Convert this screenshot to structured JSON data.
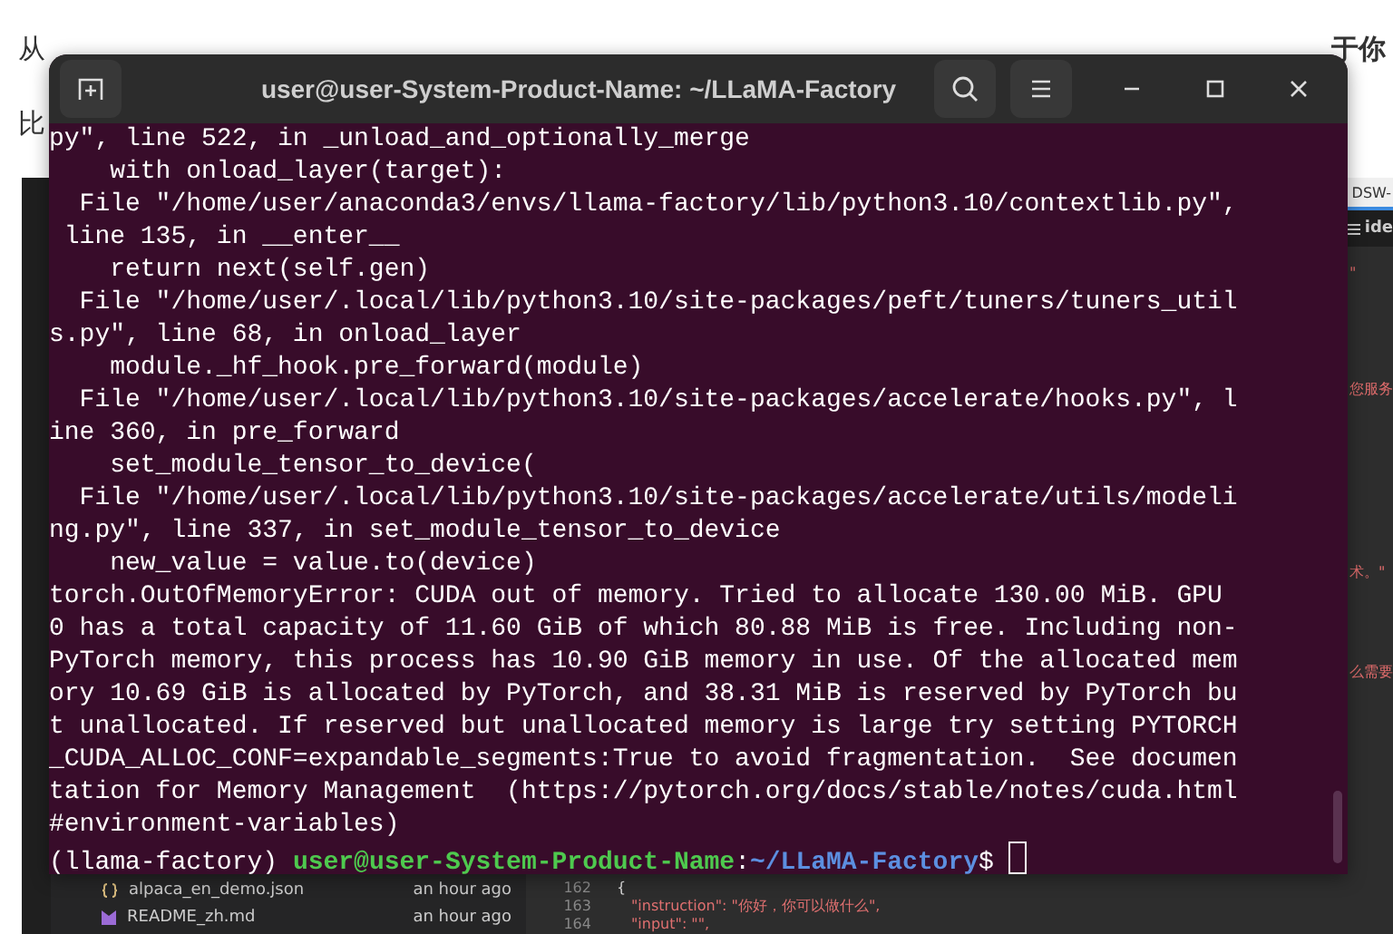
{
  "background_page": {
    "line_1_start": "从",
    "line_1_end": "于你",
    "line_2_start": "比"
  },
  "editor": {
    "top_label": "DSW-",
    "tab": "ide",
    "right_fragments": [
      "\"",
      "您服务",
      "术。\"",
      "么需要"
    ],
    "files": [
      {
        "name": "alpaca_en_demo.json",
        "kind": "json",
        "time": "an hour ago"
      },
      {
        "name": "README_zh.md",
        "kind": "markdown",
        "time": "an hour ago"
      }
    ],
    "code_lines": [
      {
        "number": "162",
        "text": "{"
      },
      {
        "number": "163",
        "text": "\"instruction\": \"你好，你可以做什么\","
      },
      {
        "number": "164",
        "text": "\"input\": \"\","
      }
    ]
  },
  "terminal": {
    "title": "user@user-System-Product-Name: ~/LLaMA-Factory",
    "output": [
      "py\", line 522, in _unload_and_optionally_merge",
      "    with onload_layer(target):",
      "  File \"/home/user/anaconda3/envs/llama-factory/lib/python3.10/contextlib.py\",",
      " line 135, in __enter__",
      "    return next(self.gen)",
      "  File \"/home/user/.local/lib/python3.10/site-packages/peft/tuners/tuners_util",
      "s.py\", line 68, in onload_layer",
      "    module._hf_hook.pre_forward(module)",
      "  File \"/home/user/.local/lib/python3.10/site-packages/accelerate/hooks.py\", l",
      "ine 360, in pre_forward",
      "    set_module_tensor_to_device(",
      "  File \"/home/user/.local/lib/python3.10/site-packages/accelerate/utils/modeli",
      "ng.py\", line 337, in set_module_tensor_to_device",
      "    new_value = value.to(device)",
      "torch.OutOfMemoryError: CUDA out of memory. Tried to allocate 130.00 MiB. GPU",
      "0 has a total capacity of 11.60 GiB of which 80.88 MiB is free. Including non-",
      "PyTorch memory, this process has 10.90 GiB memory in use. Of the allocated mem",
      "ory 10.69 GiB is allocated by PyTorch, and 38.31 MiB is reserved by PyTorch bu",
      "t unallocated. If reserved but unallocated memory is large try setting PYTORCH",
      "_CUDA_ALLOC_CONF=expandable_segments:True to avoid fragmentation.  See documen",
      "tation for Memory Management  (https://pytorch.org/docs/stable/notes/cuda.html",
      "#environment-variables)"
    ],
    "prompt": {
      "env": "(llama-factory)",
      "user_host": "user@user-System-Product-Name",
      "separator": ":",
      "path": "~/LLaMA-Factory",
      "symbol": "$"
    }
  }
}
